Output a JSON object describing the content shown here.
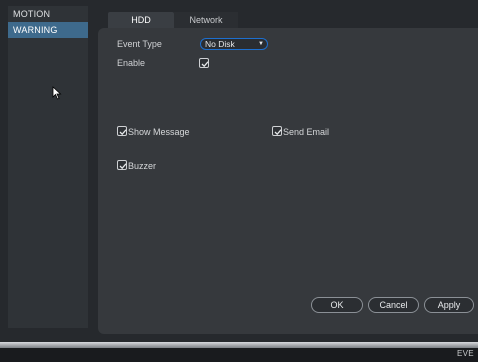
{
  "sidebar": {
    "items": [
      {
        "label": "MOTION"
      },
      {
        "label": "WARNING"
      }
    ]
  },
  "tabs": [
    {
      "label": "HDD"
    },
    {
      "label": "Network"
    }
  ],
  "form": {
    "event_type_label": "Event Type",
    "event_type_value": "No Disk",
    "enable_label": "Enable",
    "show_message_label": "Show Message",
    "send_email_label": "Send Email",
    "buzzer_label": "Buzzer",
    "enable_checked": true,
    "show_message_checked": true,
    "send_email_checked": true,
    "buzzer_checked": true
  },
  "buttons": {
    "ok": "OK",
    "cancel": "Cancel",
    "apply": "Apply"
  },
  "footer": {
    "text": "EVE"
  },
  "colors": {
    "accent": "#1d6fcf",
    "active_sidebar": "#3e6a8c"
  }
}
